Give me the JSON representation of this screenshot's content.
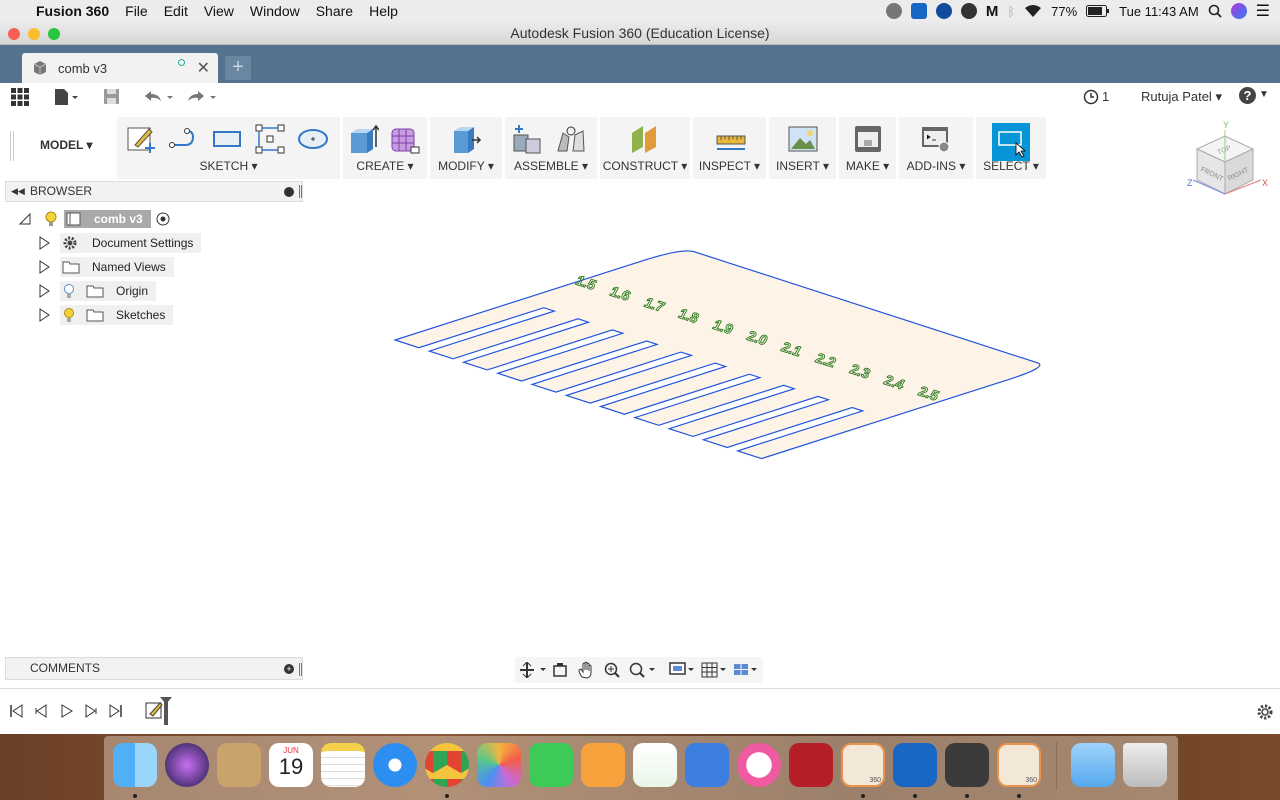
{
  "menubar": {
    "app": "Fusion 360",
    "items": [
      "File",
      "Edit",
      "View",
      "Window",
      "Share",
      "Help"
    ],
    "battery": "77%",
    "clock": "Tue 11:43 AM"
  },
  "window": {
    "title": "Autodesk Fusion 360 (Education License)"
  },
  "tab": {
    "label": "comb v3",
    "new_tab": "+"
  },
  "quick_access": {
    "job_count": "1",
    "user": "Rutuja Patel",
    "user_caret": "▾",
    "help": "?"
  },
  "toolbar": {
    "workspace": "MODEL",
    "groups": [
      {
        "label": "SKETCH"
      },
      {
        "label": "CREATE"
      },
      {
        "label": "MODIFY"
      },
      {
        "label": "ASSEMBLE"
      },
      {
        "label": "CONSTRUCT"
      },
      {
        "label": "INSPECT"
      },
      {
        "label": "INSERT"
      },
      {
        "label": "MAKE"
      },
      {
        "label": "ADD-INS"
      },
      {
        "label": "SELECT"
      }
    ]
  },
  "viewcube": {
    "top": "TOP",
    "front": "FRONT",
    "right": "RIGHT",
    "axis_x": "X",
    "axis_y": "Y",
    "axis_z": "Z"
  },
  "browser": {
    "title": "BROWSER",
    "root": "comb v3",
    "items": [
      {
        "label": "Document Settings",
        "icon": "gear-icon"
      },
      {
        "label": "Named Views",
        "icon": "folder-icon"
      },
      {
        "label": "Origin",
        "icon": "folder-icon",
        "bulb": "off"
      },
      {
        "label": "Sketches",
        "icon": "folder-icon",
        "bulb": "on"
      }
    ]
  },
  "comb": {
    "labels": [
      "1.5",
      "1.6",
      "1.7",
      "1.8",
      "1.9",
      "2.0",
      "2.1",
      "2.2",
      "2.3",
      "2.4",
      "2.5"
    ],
    "outline_color": "#2255dd",
    "fill_color": "#fdf3e7",
    "text_color": "#2a7a1e"
  },
  "comments": {
    "title": "COMMENTS"
  },
  "dock": {
    "calendar_month": "JUN",
    "calendar_day": "19",
    "fusion_badge": "360"
  }
}
